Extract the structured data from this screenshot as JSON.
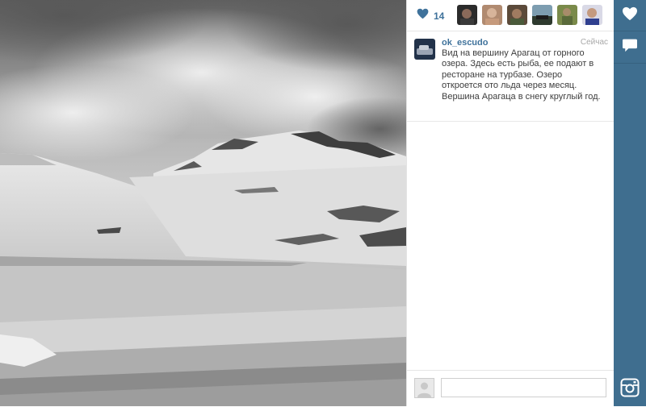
{
  "photo": {
    "subject": "snow-covered-mountain-lake"
  },
  "likes": {
    "count": "14",
    "icon": "heart-icon"
  },
  "likers": [
    {
      "name": "liker-avatar-1"
    },
    {
      "name": "liker-avatar-2"
    },
    {
      "name": "liker-avatar-3"
    },
    {
      "name": "liker-avatar-4"
    },
    {
      "name": "liker-avatar-5"
    },
    {
      "name": "liker-avatar-6"
    }
  ],
  "post": {
    "username": "ok_escudo",
    "timestamp": "Сейчас",
    "caption": "Вид на вершину Арагац от горного озера. Здесь есть рыба, ее подают в ресторане на турбазе. Озеро откроется ото льда через месяц. Вершина Арагаца в снегу круглый год."
  },
  "composer": {
    "placeholder": ""
  },
  "side": {
    "like_icon": "heart-icon",
    "comment_icon": "speech-bubble-icon",
    "logo_icon": "instagram-icon"
  },
  "colors": {
    "link": "#3f729b",
    "sidebar": "#3f6e8f"
  }
}
